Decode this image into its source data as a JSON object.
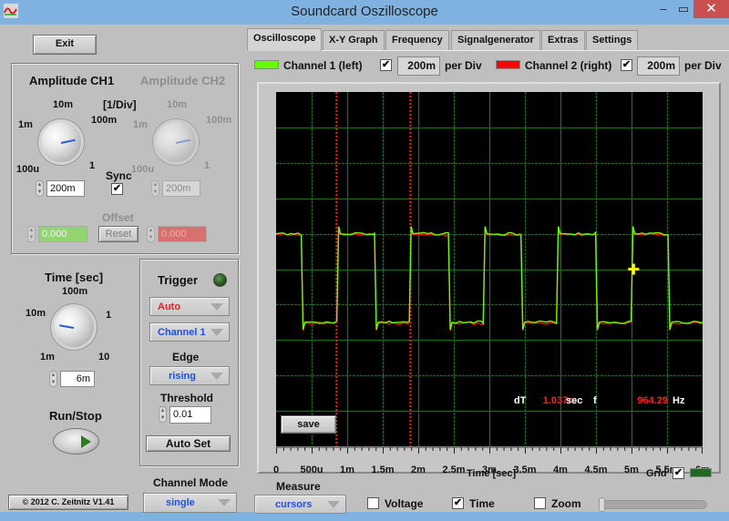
{
  "window": {
    "title": "Soundcard Oszilloscope",
    "minimize_glyph": "–",
    "maximize_glyph": "▭",
    "close_glyph": "✕"
  },
  "left": {
    "exit_label": "Exit",
    "amplitude": {
      "ch1_title": "Amplitude CH1",
      "ch2_title": "Amplitude CH2",
      "unit_label": "[1/Div]",
      "ticks": [
        "100u",
        "1m",
        "10m",
        "100m",
        "1"
      ],
      "ch1_value": "200m",
      "ch2_value": "200m",
      "sync_label": "Sync",
      "sync_checked": true,
      "offset_label": "Offset",
      "ch1_offset": "0.000",
      "ch2_offset": "0.000",
      "reset_label": "Reset"
    },
    "time": {
      "title": "Time [sec]",
      "ticks": [
        "1m",
        "10m",
        "100m",
        "1",
        "10"
      ],
      "value": "6m"
    },
    "run_stop_label": "Run/Stop",
    "copyright_label": "© 2012  C. Zeitnitz V1.41",
    "trigger": {
      "title": "Trigger",
      "mode": "Auto",
      "channel": "Channel 1",
      "edge_label": "Edge",
      "edge": "rising",
      "threshold_label": "Threshold",
      "threshold": "0.01",
      "auto_set_label": "Auto Set"
    },
    "channel_mode": {
      "label": "Channel Mode",
      "value": "single"
    }
  },
  "tabs": [
    {
      "label": "Oscilloscope",
      "active": true
    },
    {
      "label": "X-Y Graph",
      "active": false
    },
    {
      "label": "Frequency",
      "active": false
    },
    {
      "label": "Signalgenerator",
      "active": false
    },
    {
      "label": "Extras",
      "active": false
    },
    {
      "label": "Settings",
      "active": false
    }
  ],
  "channels": {
    "ch1": {
      "label": "Channel 1 (left)",
      "color": "#66ff00",
      "enabled": true,
      "per_div": "200m",
      "per_div_label": "per Div"
    },
    "ch2": {
      "label": "Channel 2 (right)",
      "color": "#ff0000",
      "enabled": true,
      "per_div": "200m",
      "per_div_label": "per Div"
    }
  },
  "scope": {
    "save_label": "save",
    "dT_label": "dT",
    "dT_value": "1.037m",
    "dT_unit": "sec",
    "f_label": "f",
    "f_value": "964.29",
    "f_unit": "Hz",
    "xlabel": "Time [sec]",
    "grid_label": "Grid",
    "grid_checked": true,
    "grid_color": "#1f6a1f"
  },
  "measure": {
    "label": "Measure",
    "mode": "cursors",
    "voltage_label": "Voltage",
    "voltage_checked": false,
    "time_label": "Time",
    "time_checked": true,
    "zoom_label": "Zoom",
    "zoom_checked": false
  },
  "chart_data": {
    "type": "line",
    "title": "",
    "xlabel": "Time [sec]",
    "ylabel": "",
    "xlim": [
      0,
      0.006
    ],
    "ylim": [
      -1.0,
      1.0
    ],
    "grid": true,
    "x_ticks": [
      "0",
      "500u",
      "1m",
      "1.5m",
      "2m",
      "2.5m",
      "3m",
      "3.5m",
      "4m",
      "4.5m",
      "5m",
      "5.5m",
      "6m"
    ],
    "x_divisions": 12,
    "y_divisions": 10,
    "series": [
      {
        "name": "Channel 1 (left)",
        "color": "#66ff00",
        "shape": "square",
        "high": 0.2,
        "low": -0.3,
        "rising_edges": [
          0.00088,
          0.0019,
          0.00294,
          0.00397,
          0.00502
        ],
        "falling_edges": [
          0.00038,
          0.00141,
          0.00245,
          0.00347,
          0.00452,
          0.00554
        ]
      },
      {
        "name": "Channel 2 (right)",
        "color": "#ff0000",
        "shape": "square",
        "high": 0.2,
        "low": -0.3,
        "rising_edges": [
          0.00088,
          0.0019,
          0.00294,
          0.00397,
          0.00502
        ],
        "falling_edges": [
          0.00038,
          0.00141,
          0.00245,
          0.00347,
          0.00452,
          0.00554
        ]
      }
    ],
    "time_cursors": [
      0.00085,
      0.00189
    ],
    "marker": {
      "x": 0.00503,
      "y": 0.0
    }
  }
}
